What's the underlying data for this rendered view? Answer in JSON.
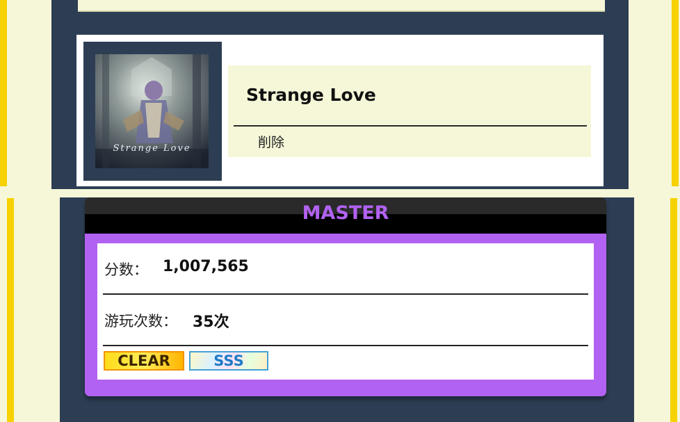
{
  "song": {
    "title": "Strange Love",
    "artist": "削除",
    "jacket_text": "Strange Love"
  },
  "difficulty": {
    "label": "MASTER",
    "color": "#b262f2"
  },
  "stats": {
    "score_label": "分数：",
    "score_value": "1,007,565",
    "plays_label": "游玩次数：",
    "plays_value": "35次"
  },
  "badges": {
    "clear": "CLEAR",
    "rank": "SSS"
  },
  "colors": {
    "panel": "#2d3e54",
    "card_bg": "#f6f7d8",
    "accent_yellow": "#f7d100"
  }
}
